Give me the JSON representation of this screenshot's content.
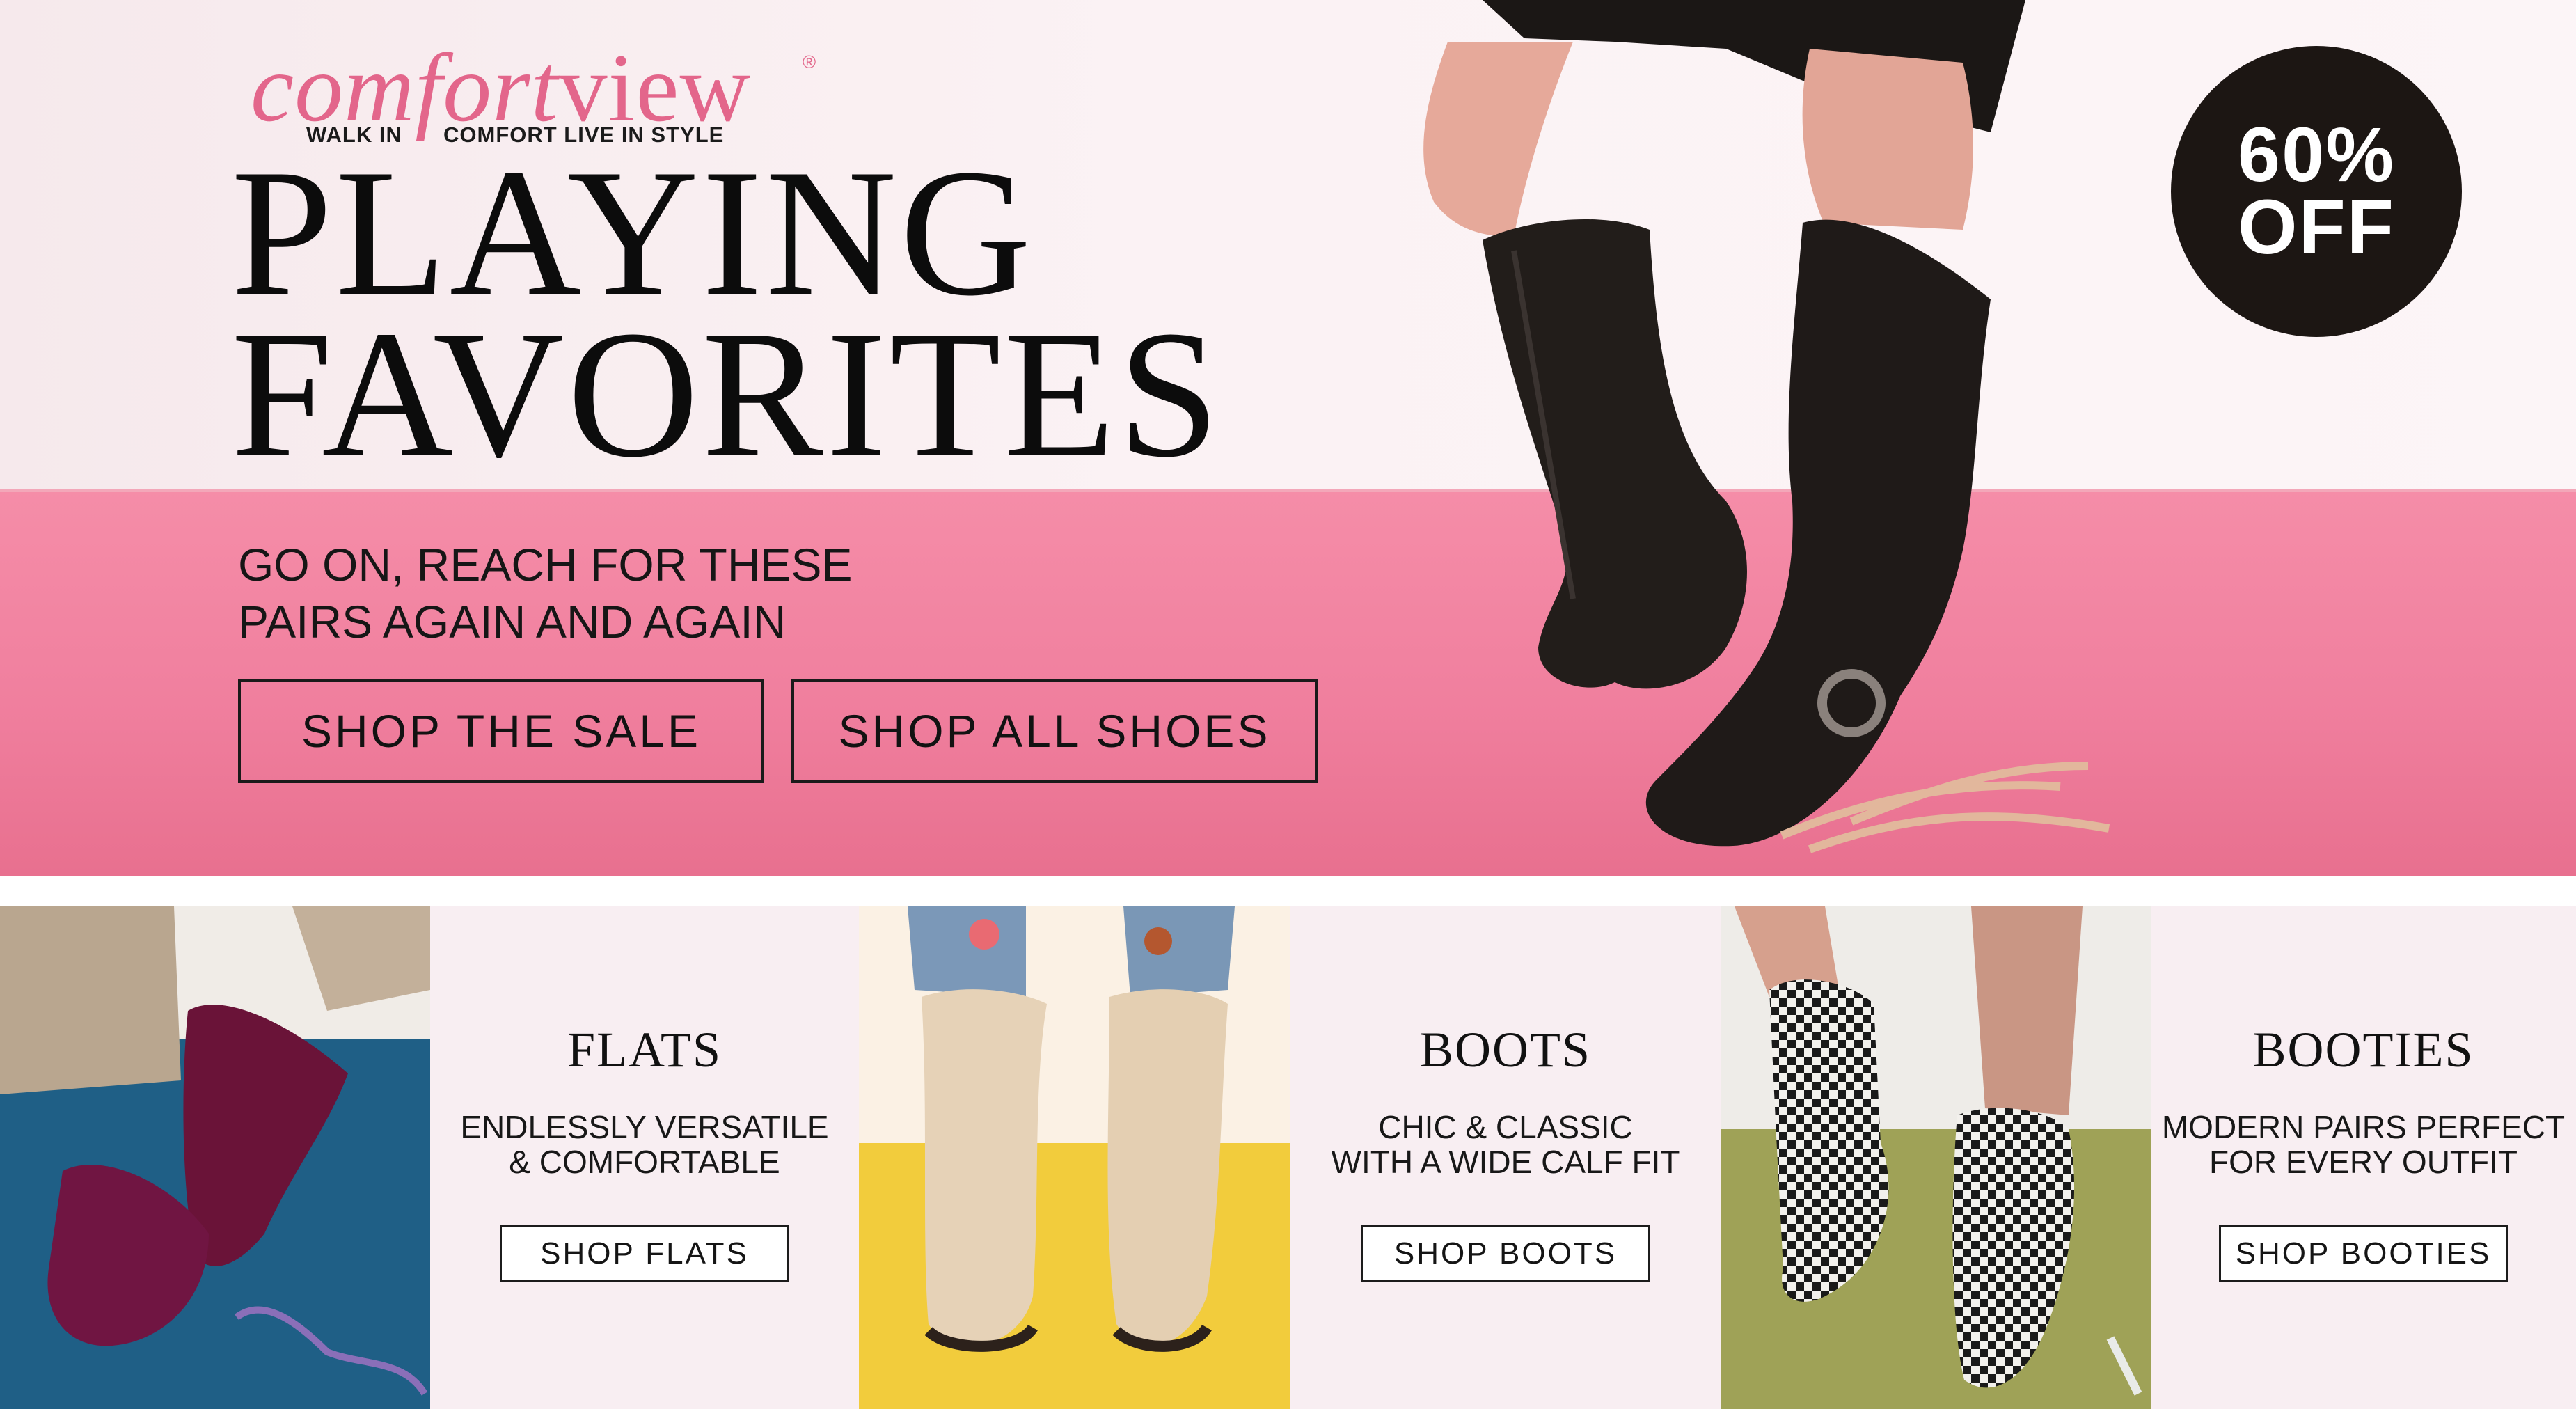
{
  "brand": {
    "name_plain": "comfort",
    "name_bold": "view",
    "registered_mark": "®",
    "tagline_left": "WALK IN",
    "tagline_right": "COMFORT LIVE IN STYLE",
    "color": "#e3668b"
  },
  "hero": {
    "headline_line1": "PLAYING",
    "headline_line2": "FAVORITES",
    "subcopy_line1": "GO ON, REACH FOR THESE",
    "subcopy_line2": "PAIRS AGAIN AND AGAIN",
    "button_sale": "SHOP THE SALE",
    "button_all": "SHOP ALL SHOES",
    "badge_line1": "60%",
    "badge_line2": "OFF",
    "background_top": "#fbf2f4",
    "background_floor": "#f07f9e"
  },
  "categories": [
    {
      "title": "FLATS",
      "desc_line1": "ENDLESSLY VERSATILE",
      "desc_line2": "& COMFORTABLE",
      "button": "SHOP FLATS",
      "photo_icon": "burgundy-flats-image"
    },
    {
      "title": "BOOTS",
      "desc_line1": "CHIC & CLASSIC",
      "desc_line2": "WITH A WIDE CALF FIT",
      "button": "SHOP BOOTS",
      "photo_icon": "tan-slouch-boots-image"
    },
    {
      "title": "BOOTIES",
      "desc_line1": "MODERN PAIRS PERFECT",
      "desc_line2": "FOR EVERY OUTFIT",
      "button": "SHOP BOOTIES",
      "photo_icon": "houndstooth-booties-image"
    }
  ]
}
